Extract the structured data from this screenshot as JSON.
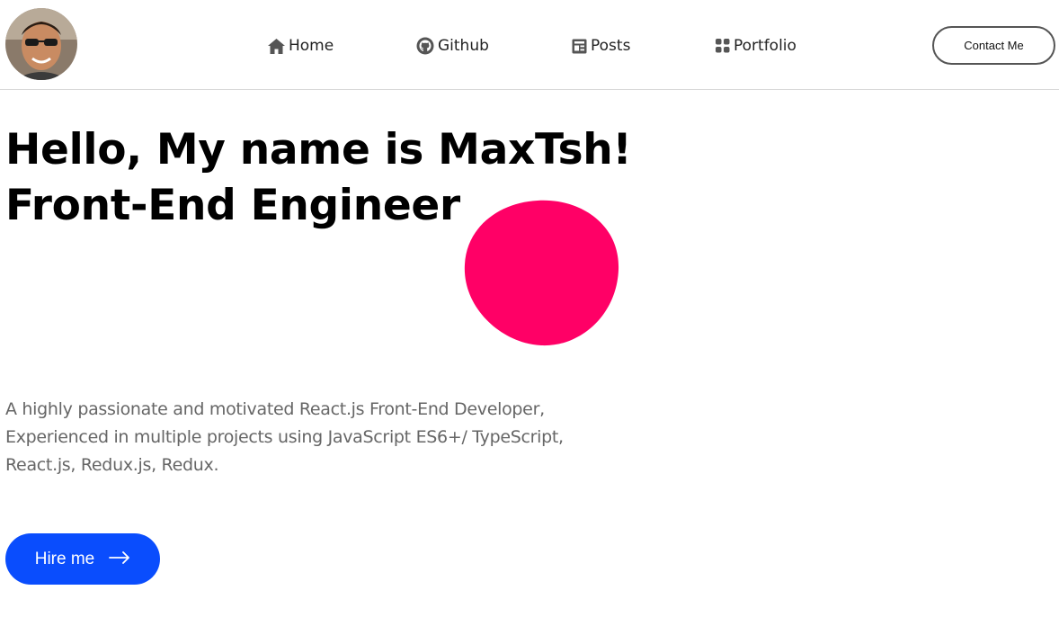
{
  "header": {
    "avatar_alt": "profile photo",
    "nav": [
      {
        "label": "Home",
        "icon": "home-icon"
      },
      {
        "label": "Github",
        "icon": "github-icon"
      },
      {
        "label": "Posts",
        "icon": "posts-icon"
      },
      {
        "label": "Portfolio",
        "icon": "portfolio-icon"
      }
    ],
    "contact_label": "Contact Me"
  },
  "hero": {
    "title_line1": "Hello, My name is MaxTsh!",
    "title_line2": "Front-End Engineer",
    "description_line1": "A highly passionate and motivated React.js Front-End Developer,",
    "description_line2": "Experienced in multiple projects using JavaScript ES6+/ TypeScript,",
    "description_line3": "React.js, Redux.js, Redux.",
    "hire_label": "Hire me",
    "hire_icon": "arrow-right-icon"
  },
  "colors": {
    "accent_blob": "#ff0066",
    "button_blue": "#0a4dfd"
  }
}
